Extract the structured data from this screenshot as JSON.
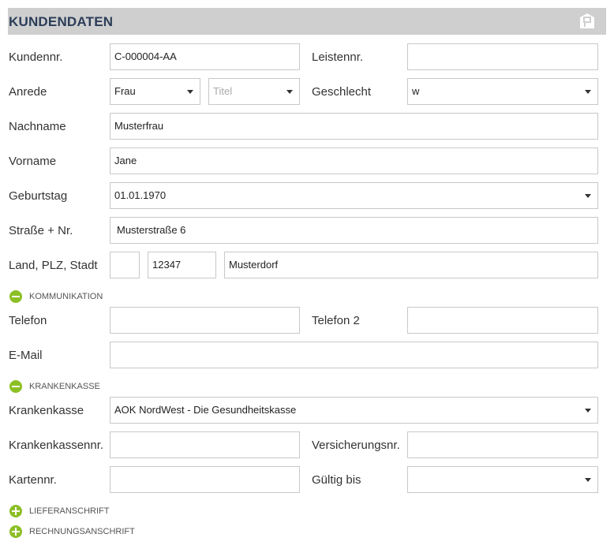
{
  "header": {
    "title": "KUNDENDATEN",
    "icon": "parking-badge-icon"
  },
  "labels": {
    "kundennr": "Kundennr.",
    "leistennr": "Leistennr.",
    "anrede": "Anrede",
    "geschlecht": "Geschlecht",
    "nachname": "Nachname",
    "vorname": "Vorname",
    "geburtstag": "Geburtstag",
    "strasse": "Straße + Nr.",
    "land_plz_stadt": "Land, PLZ, Stadt",
    "telefon": "Telefon",
    "telefon2": "Telefon 2",
    "email": "E-Mail",
    "krankenkasse": "Krankenkasse",
    "krankenkassennr": "Krankenkassennr.",
    "versicherungsnr": "Versicherungsnr.",
    "kartennr": "Kartennr.",
    "gueltig_bis": "Gültig bis"
  },
  "values": {
    "kundennr": "C-000004-AA",
    "leistennr": "",
    "anrede": "Frau",
    "titel_placeholder": "Titel",
    "geschlecht": "w",
    "nachname": "Musterfrau",
    "vorname": "Jane",
    "geburtstag": "01.01.1970",
    "strasse": "Musterstraße 6",
    "land": "",
    "plz": "12347",
    "stadt": "Musterdorf",
    "telefon": "",
    "telefon2": "",
    "email": "",
    "krankenkasse": "AOK NordWest - Die Gesundheitskasse",
    "krankenkassennr": "",
    "versicherungsnr": "",
    "kartennr": "",
    "gueltig_bis": ""
  },
  "sections": {
    "kommunikation": {
      "label": "KOMMUNIKATION",
      "state": "expanded"
    },
    "krankenkasse": {
      "label": "KRANKENKASSE",
      "state": "expanded"
    },
    "lieferanschrift": {
      "label": "LIEFERANSCHRIFT",
      "state": "collapsed"
    },
    "rechnungsanschrift": {
      "label": "RECHNUNGSANSCHRIFT",
      "state": "collapsed"
    }
  },
  "colors": {
    "header_bg": "#cfcfcf",
    "header_text": "#2b3d58",
    "accent_green": "#8cbf26"
  }
}
